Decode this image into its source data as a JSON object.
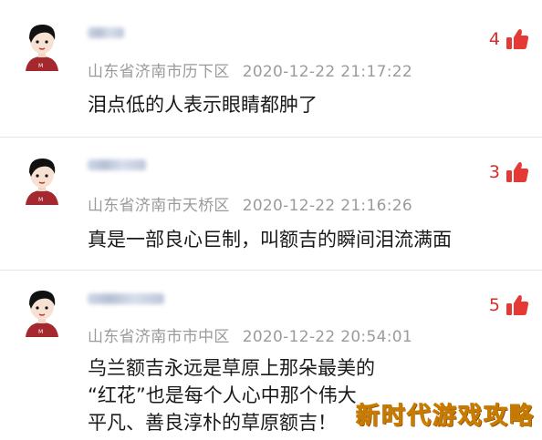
{
  "comments": [
    {
      "location": "山东省济南市历下区",
      "timestamp": "2020-12-22 21:17:22",
      "likes": "4",
      "text_lines": [
        "泪点低的人表示眼睛都肿了"
      ]
    },
    {
      "location": "山东省济南市天桥区",
      "timestamp": "2020-12-22 21:16:26",
      "likes": "3",
      "text_lines": [
        "真是一部良心巨制，叫额吉的瞬间泪流满面"
      ]
    },
    {
      "location": "山东省济南市市中区",
      "timestamp": "2020-12-22 20:54:01",
      "likes": "5",
      "text_lines": [
        "乌兰额吉永远是草原上那朵最美的",
        "“红花”也是每个人心中那个伟大",
        "平凡、善良淳朴的草原额吉！"
      ]
    }
  ],
  "watermark": "新时代游戏攻略",
  "colors": {
    "accent": "#d72c2c",
    "meta": "#9b9b9b",
    "watermark": "#f2b705"
  },
  "icons": [
    "avatar-icon",
    "thumbs-up-icon"
  ]
}
